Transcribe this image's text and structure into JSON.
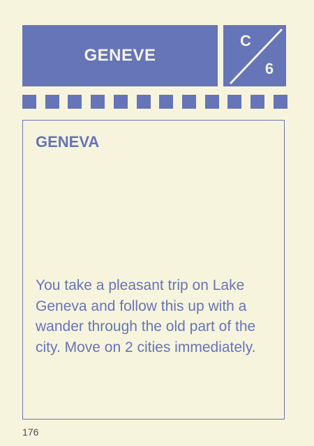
{
  "card": {
    "header_title": "GENEVE",
    "code_letter": "C",
    "code_number": "6",
    "film_squares": 12,
    "heading": "GENEVA",
    "body": "You take a pleasant trip on Lake Geneva and follow this up with a wander through the old part of the city. Move on 2 cities immediately.",
    "page_number": "176"
  },
  "colors": {
    "accent": "#6674b8",
    "background": "#f7f4dd"
  }
}
